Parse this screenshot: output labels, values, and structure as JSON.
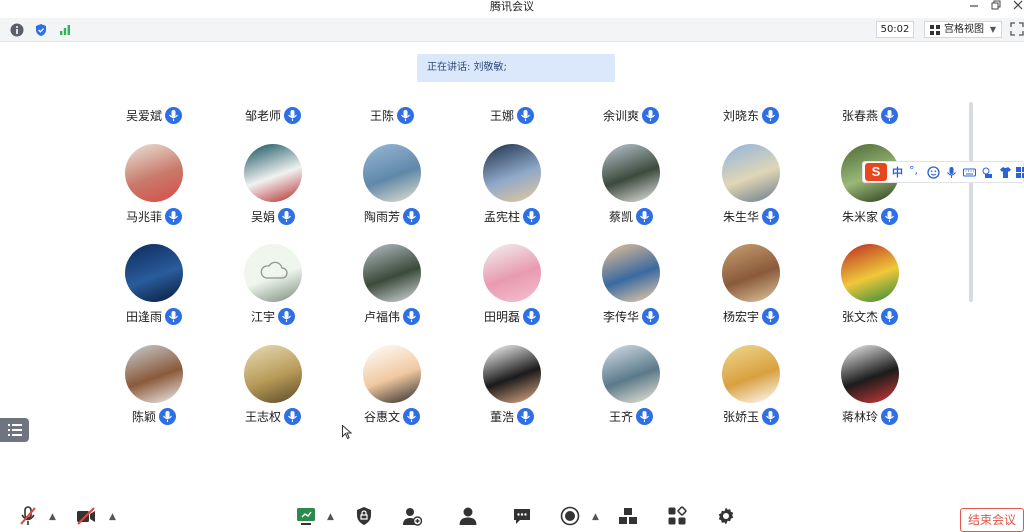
{
  "window": {
    "title": "腾讯会议"
  },
  "toolbar": {
    "timer": "50:02",
    "view_label": "宫格视图"
  },
  "speaking": {
    "label": "正在讲话: 刘敬敏;"
  },
  "header_names": [
    "吴爱斌",
    "邹老师",
    "王陈",
    "王娜",
    "余训爽",
    "刘晓东",
    "张春燕"
  ],
  "rows": [
    {
      "avatar_colors": [
        [
          "#e9e5da",
          "#c87a6a",
          "#d84b4b"
        ],
        [
          "#0f4f5c",
          "#f1f1f1",
          "#b22a2a"
        ],
        [
          "#9ab8d8",
          "#5f88a8",
          "#e8e2d0"
        ],
        [
          "#1c2f48",
          "#8fa8c8",
          "#e6c9a0"
        ],
        [
          "#bcc9d4",
          "#3c4a3c",
          "#e8e8e8"
        ],
        [
          "#8fb4e0",
          "#e0d6b6",
          "#6a7a8a"
        ],
        [
          "#4c6a34",
          "#9ab878",
          "#2a3a1c"
        ]
      ],
      "names": [
        "马兆菲",
        "吴娟",
        "陶雨芳",
        "孟宪柱",
        "蔡凯",
        "朱生华",
        "朱米家"
      ]
    },
    {
      "avatar_colors": [
        [
          "#0c2a5c",
          "#2a5c9c",
          "#061a3a"
        ],
        [
          "#eef6ee",
          "#eef6ee",
          "#7a8a7a"
        ],
        [
          "#b8c0c8",
          "#3a4a3a",
          "#d8dce0"
        ],
        [
          "#f2f2f2",
          "#e89ab0",
          "#f4c2d0"
        ],
        [
          "#e8c098",
          "#3a6aa0",
          "#f0d0a8"
        ],
        [
          "#c8a070",
          "#8a5a3a",
          "#e0c8a0"
        ],
        [
          "#b82a22",
          "#f0c83a",
          "#2a8a3a"
        ]
      ],
      "names": [
        "田逢雨",
        "江宇",
        "卢福伟",
        "田明磊",
        "李传华",
        "杨宏宇",
        "张文杰"
      ]
    },
    {
      "avatar_colors": [
        [
          "#c8cdd2",
          "#8a5a3a",
          "#f0f0f0"
        ],
        [
          "#e8dcb8",
          "#b89a58",
          "#5a4a2a"
        ],
        [
          "#ffffff",
          "#f0c8a0",
          "#2a2a2a"
        ],
        [
          "#ffffff",
          "#1a1a1a",
          "#e8b08a"
        ],
        [
          "#d8e0e8",
          "#5a7a8a",
          "#f0e8d8"
        ],
        [
          "#f0d890",
          "#d8a040",
          "#ffffff"
        ],
        [
          "#f0f0f0",
          "#1c1c1c",
          "#d83a3a"
        ]
      ],
      "names": [
        "陈颖",
        "王志权",
        "谷惠文",
        "董浩",
        "王齐",
        "张娇玉",
        "蒋林玲"
      ]
    }
  ],
  "ime": {
    "logo": "S",
    "zh": "中",
    "punct": "°,"
  },
  "footer": {
    "end_label": "结束会议"
  }
}
